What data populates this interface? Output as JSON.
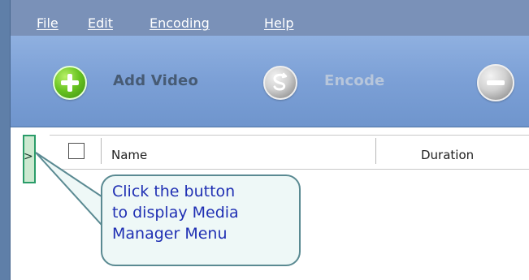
{
  "menubar": {
    "items": [
      "File",
      "Edit",
      "Encoding",
      "Help"
    ]
  },
  "toolbar": {
    "add_video_label": "Add Video",
    "encode_label": "Encode",
    "icons": {
      "add": "plus-circle-icon",
      "encode": "encode-circle-icon",
      "remove": "minus-circle-icon"
    }
  },
  "media_panel": {
    "expand_arrow": ">",
    "columns": [
      "Name",
      "Duration"
    ]
  },
  "callout": {
    "lines": [
      "Click the button",
      "to display Media",
      "Manager Menu"
    ]
  },
  "colors": {
    "menubar": "#7a91b8",
    "toolbar": "#7ca0d6",
    "handle_border": "#2a9c69",
    "callout_border": "#5a8a92",
    "callout_text": "#1f2fb3"
  }
}
